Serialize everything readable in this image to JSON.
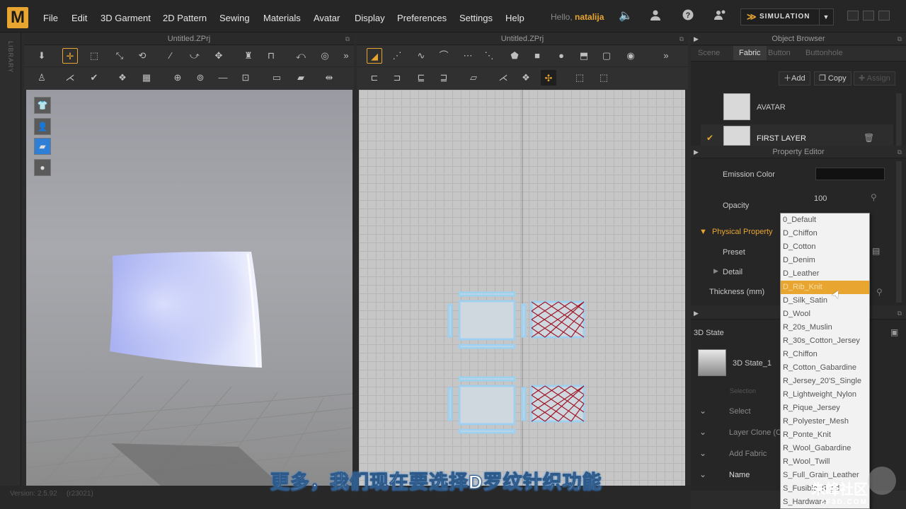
{
  "menubar": {
    "logo": "M",
    "items": [
      "File",
      "Edit",
      "3D Garment",
      "2D Pattern",
      "Sewing",
      "Materials",
      "Avatar",
      "Display",
      "Preferences",
      "Settings",
      "Help"
    ],
    "hello_prefix": "Hello,",
    "username": "natalija",
    "simulation_label": "SIMULATION"
  },
  "sidebar": {
    "label": "LIBRARY"
  },
  "panel3d": {
    "title": "Untitled.ZPrj"
  },
  "panel2d": {
    "title": "Untitled.ZPrj"
  },
  "object_browser": {
    "title": "Object Browser",
    "tabs": [
      "Scene",
      "Fabric",
      "Button",
      "Buttonhole"
    ],
    "active_tab": "Fabric",
    "buttons": {
      "add": "Add",
      "copy": "Copy",
      "assign": "Assign"
    },
    "items": [
      {
        "name": "AVATAR"
      },
      {
        "name": "FIRST LAYER",
        "checked": true
      }
    ]
  },
  "property_editor": {
    "title": "Property Editor",
    "emission_color_label": "Emission Color",
    "opacity_label": "Opacity",
    "opacity_value": "100",
    "physical_property_label": "Physical Property",
    "preset_label": "Preset",
    "detail_label": "Detail",
    "thickness_label": "Thickness (mm)"
  },
  "state_panel": {
    "title": "3D State",
    "state_name": "3D State_1",
    "rows": [
      "Selection",
      "Select",
      "Layer Clone (C",
      "Add Fabric",
      "Name"
    ]
  },
  "preset_dropdown": {
    "options": [
      "0_Default",
      "D_Chiffon",
      "D_Cotton",
      "D_Denim",
      "D_Leather",
      "D_Rib_Knit",
      "D_Silk_Satin",
      "D_Wool",
      "R_20s_Muslin",
      "R_30s_Cotton_Jersey",
      "R_Chiffon",
      "R_Cotton_Gabardine",
      "R_Jersey_20'S_Single",
      "R_Lightweight_Nylon",
      "R_Pique_Jersey",
      "R_Polyester_Mesh",
      "R_Ponte_Knit",
      "R_Wool_Gabardine",
      "R_Wool_Twill",
      "S_Full_Grain_Leather",
      "S_Fusible_Rigid",
      "S_Hardware"
    ],
    "highlighted_index": 5
  },
  "statusbar": {
    "version": "Version: 2.5.92",
    "build": "(r23021)"
  },
  "overlay": {
    "subtitle": "更多，我们现在要选择D罗纹针织功能",
    "watermark": "朱峰社区",
    "watermark_url": "ZF3D.COM"
  },
  "colors": {
    "accent": "#e8a530",
    "panel_bg": "#262626",
    "garment": "#c9d0f7"
  }
}
